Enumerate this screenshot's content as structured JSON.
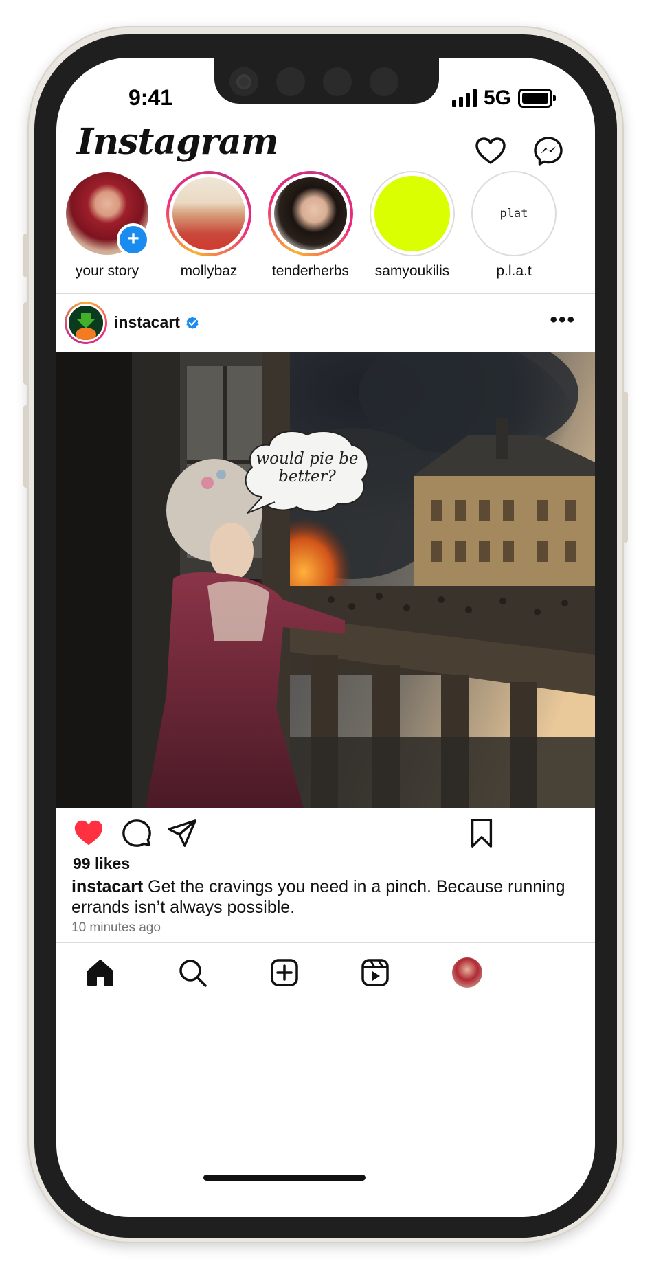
{
  "status_bar": {
    "time": "9:41",
    "network": "5G"
  },
  "header": {
    "logo": "Instagram",
    "icons": [
      "heart-icon",
      "messenger-icon"
    ]
  },
  "stories": [
    {
      "label": "your story",
      "ring": "none",
      "has_add_badge": true,
      "add_symbol": "+"
    },
    {
      "label": "mollybaz",
      "ring": "gradient"
    },
    {
      "label": "tenderherbs",
      "ring": "gradient"
    },
    {
      "label": "samyoukilis",
      "ring": "seen"
    },
    {
      "label": "p.l.a.t",
      "ring": "seen",
      "avatar_text": "plat"
    }
  ],
  "post": {
    "username": "instacart",
    "verified": true,
    "more_label": "•••",
    "speech_bubble": "would pie be better?",
    "liked": true,
    "likes": "99 likes",
    "caption_user": "instacart",
    "caption_text": " Get the cravings you need in a pinch. Because running errands isn’t always possible.",
    "time_ago": "10 minutes ago"
  },
  "colors": {
    "like_red": "#ff3040",
    "story_gradient": [
      "#f9b233",
      "#ee2a7b",
      "#c13584"
    ],
    "badge_blue": "#1a8cf0",
    "samyoukilis_fill": "#d9ff00"
  },
  "tab_bar": [
    "home-icon",
    "search-icon",
    "create-icon",
    "reels-icon",
    "profile-avatar"
  ]
}
